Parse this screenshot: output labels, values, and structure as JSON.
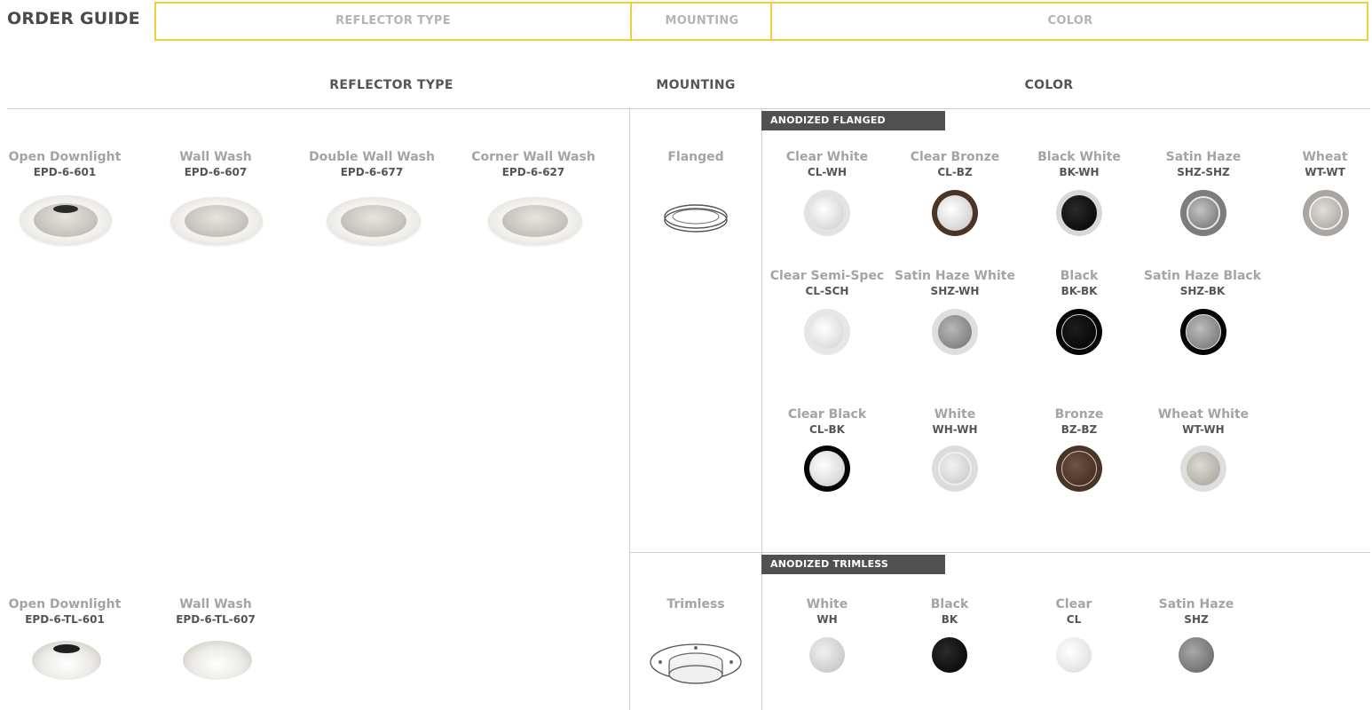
{
  "title": "ORDER GUIDE",
  "steps": [
    "REFLECTOR TYPE",
    "MOUNTING",
    "COLOR"
  ],
  "headers": {
    "reflector": "REFLECTOR TYPE",
    "mounting": "MOUNTING",
    "color": "COLOR"
  },
  "flanged": {
    "mounting_label": "Flanged",
    "badge": "ANODIZED FLANGED",
    "reflectors": [
      {
        "name": "Open Downlight",
        "code": "EPD-6-601"
      },
      {
        "name": "Wall Wash",
        "code": "EPD-6-607"
      },
      {
        "name": "Double Wall Wash",
        "code": "EPD-6-677"
      },
      {
        "name": "Corner Wall Wash",
        "code": "EPD-6-627"
      }
    ],
    "colors": [
      {
        "name": "Clear White",
        "code": "CL-WH"
      },
      {
        "name": "Clear Bronze",
        "code": "CL-BZ"
      },
      {
        "name": "Black White",
        "code": "BK-WH"
      },
      {
        "name": "Satin Haze",
        "code": "SHZ-SHZ"
      },
      {
        "name": "Wheat",
        "code": "WT-WT"
      },
      {
        "name": "Clear Semi-Spec",
        "code": "CL-SCH"
      },
      {
        "name": "Satin Haze White",
        "code": "SHZ-WH"
      },
      {
        "name": "Black",
        "code": "BK-BK"
      },
      {
        "name": "Satin Haze Black",
        "code": "SHZ-BK"
      },
      {
        "name": "Clear Black",
        "code": "CL-BK"
      },
      {
        "name": "White",
        "code": "WH-WH"
      },
      {
        "name": "Bronze",
        "code": "BZ-BZ"
      },
      {
        "name": "Wheat White",
        "code": "WT-WH"
      }
    ]
  },
  "trimless": {
    "mounting_label": "Trimless",
    "badge": "ANODIZED TRIMLESS",
    "reflectors": [
      {
        "name": "Open Downlight",
        "code": "EPD-6-TL-601"
      },
      {
        "name": "Wall Wash",
        "code": "EPD-6-TL-607"
      }
    ],
    "colors": [
      {
        "name": "White",
        "code": "WH"
      },
      {
        "name": "Black",
        "code": "BK"
      },
      {
        "name": "Clear",
        "code": "CL"
      },
      {
        "name": "Satin Haze",
        "code": "SHZ"
      }
    ]
  },
  "palette": {
    "accent_border": "#f2cf3a",
    "badge_bg": "#505050",
    "clear": "#e6e6e6",
    "black": "#0a0a0a",
    "bronze": "#4a3426",
    "satin_haze": "#8a8a8a",
    "wheat": "#b8b4ae",
    "white": "#d9d9d9"
  }
}
